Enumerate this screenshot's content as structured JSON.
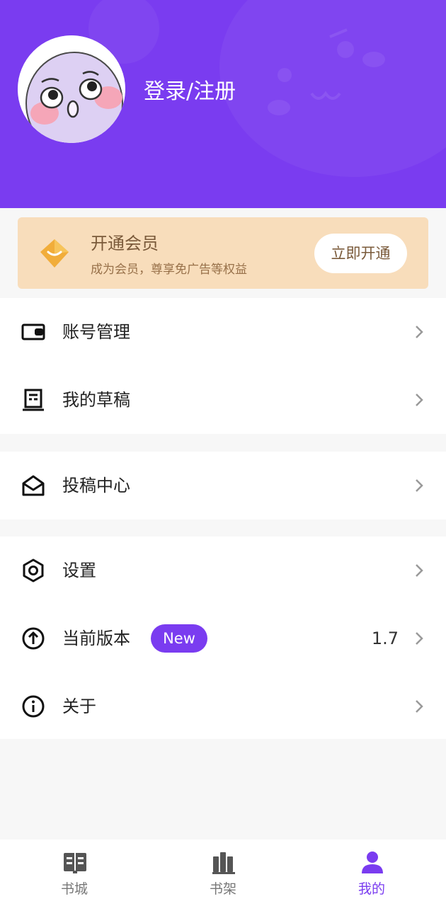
{
  "header": {
    "login_label": "登录/注册"
  },
  "vip": {
    "title": "开通会员",
    "subtitle": "成为会员，尊享免广告等权益",
    "button_label": "立即开通"
  },
  "menu": {
    "account": "账号管理",
    "drafts": "我的草稿",
    "submission": "投稿中心",
    "settings": "设置",
    "version_label": "当前版本",
    "version_badge": "New",
    "version_value": "1.7",
    "about": "关于"
  },
  "tabs": [
    {
      "label": "书城",
      "icon": "book-open-icon"
    },
    {
      "label": "书架",
      "icon": "bookshelf-icon"
    },
    {
      "label": "我的",
      "icon": "person-icon"
    }
  ],
  "colors": {
    "brand": "#7a3cf0",
    "vip_bg": "#f8ddbb",
    "vip_text": "#7a5a3a"
  }
}
